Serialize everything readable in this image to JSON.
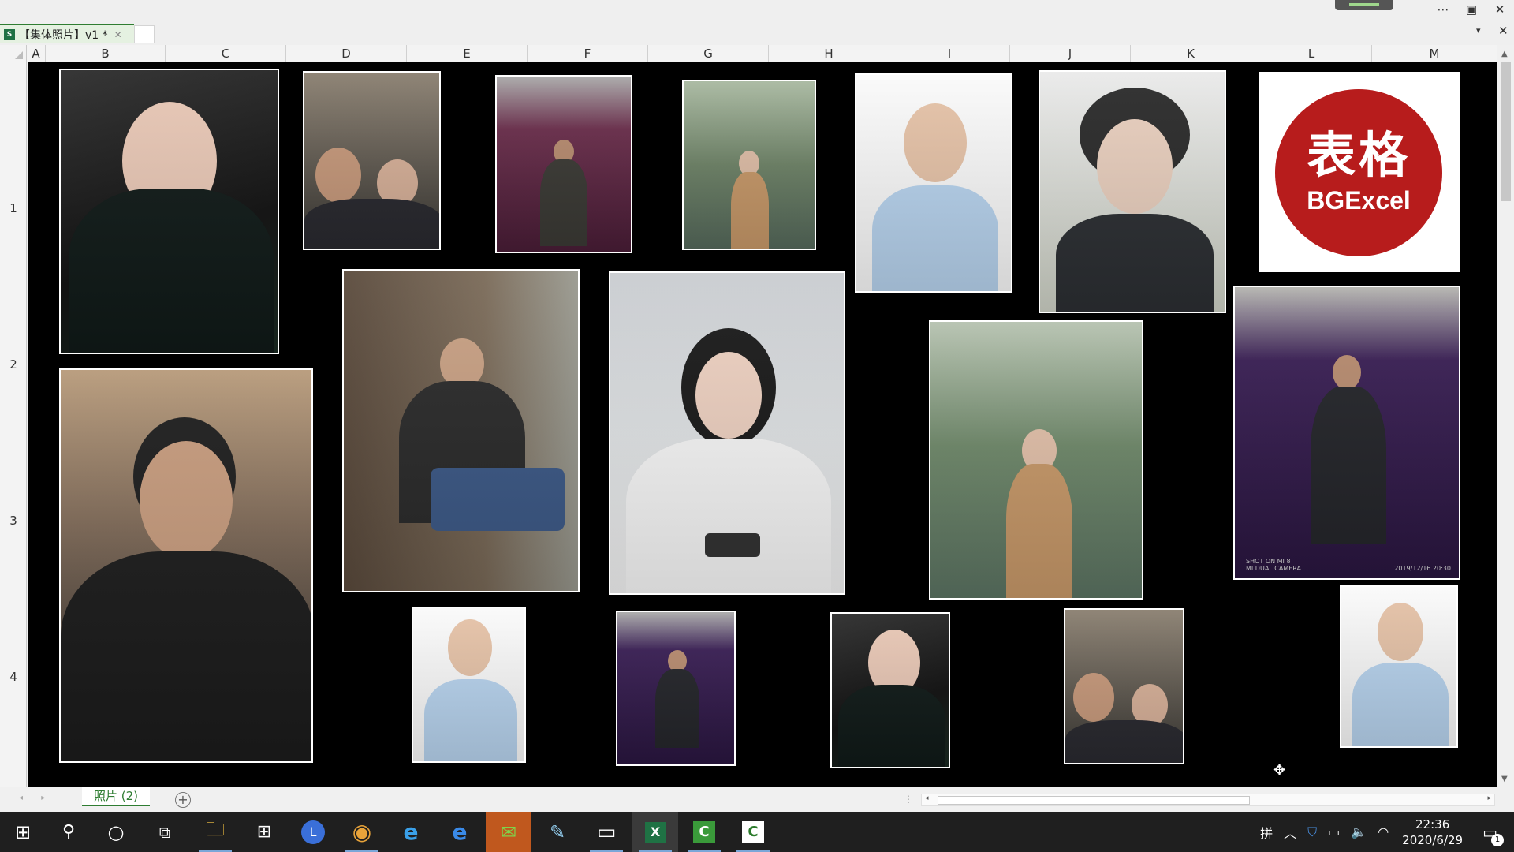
{
  "window": {
    "document_tab_title": "【集体照片】v1 *",
    "doc_icon_letter": "S",
    "controls": {
      "more": "⋯",
      "restore": "▣",
      "close": "✕"
    },
    "tab_dropdown": "▾",
    "tab_close": "✕"
  },
  "grid": {
    "columns": [
      "A",
      "B",
      "C",
      "D",
      "E",
      "F",
      "G",
      "H",
      "I",
      "J",
      "K",
      "L",
      "M"
    ],
    "rows": [
      "1",
      "2",
      "3",
      "4"
    ]
  },
  "logo": {
    "hanzi": "表格",
    "text": "BGExcel"
  },
  "photo_stamps": {
    "camera": "SHOT ON MI 8\nMI DUAL CAMERA",
    "date": "2019/12/16 20:30"
  },
  "sheet_tabs": {
    "active": "照片 (2)",
    "add": "+",
    "nav": "◂ ▸"
  },
  "scroll": {
    "up": "▲",
    "down": "▼",
    "left": "◂",
    "right": "▸",
    "split": "⋮"
  },
  "taskbar": {
    "apps": [
      {
        "name": "start",
        "glyph": "⊞"
      },
      {
        "name": "search",
        "glyph": "⚲"
      },
      {
        "name": "cortana",
        "glyph": "○"
      },
      {
        "name": "task-view",
        "glyph": "⧉"
      },
      {
        "name": "file-explorer",
        "glyph": "🗀"
      },
      {
        "name": "store",
        "glyph": "⊞"
      },
      {
        "name": "clock-app",
        "glyph": "L"
      },
      {
        "name": "chrome",
        "glyph": "◉"
      },
      {
        "name": "ie",
        "glyph": "e"
      },
      {
        "name": "edge",
        "glyph": "e"
      },
      {
        "name": "wechat",
        "glyph": "✉"
      },
      {
        "name": "notes",
        "glyph": "✎"
      },
      {
        "name": "terminal",
        "glyph": "▭"
      },
      {
        "name": "excel",
        "glyph": "X"
      },
      {
        "name": "camtasia-1",
        "glyph": "C"
      },
      {
        "name": "camtasia-2",
        "glyph": "C"
      }
    ],
    "tray": {
      "ime": "拼",
      "chevron": "︿",
      "shield": "⛉",
      "battery": "▭",
      "volume": "🔈",
      "wifi": "◠"
    },
    "time": "22:36",
    "date": "2020/6/29",
    "notifications": "1"
  },
  "colors": {
    "accent": "#2f7d32",
    "sheet_bg": "#000000",
    "logo_red": "#b71c1c"
  }
}
